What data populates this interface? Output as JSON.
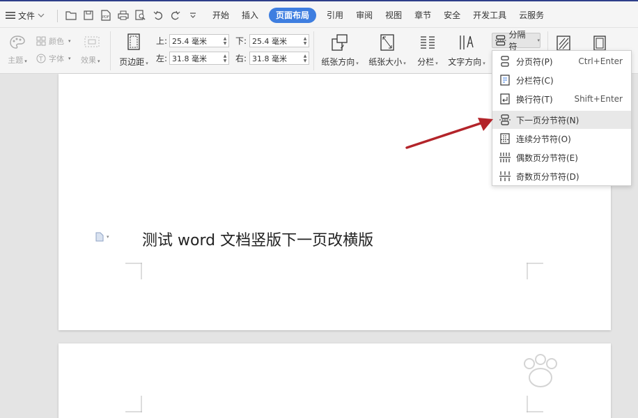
{
  "menubar": {
    "file_label": "文件",
    "tabs": [
      "开始",
      "插入",
      "页面布局",
      "引用",
      "审阅",
      "视图",
      "章节",
      "安全",
      "开发工具",
      "云服务"
    ],
    "active_tab": "页面布局"
  },
  "toolbar": {
    "theme_label": "主题",
    "color_label": "颜色",
    "font_label": "字体",
    "effect_label": "效果",
    "margin_label": "页边距",
    "top_label": "上:",
    "top_value": "25.4 毫米",
    "bottom_label": "下:",
    "bottom_value": "25.4 毫米",
    "left_label": "左:",
    "left_value": "31.8 毫米",
    "right_label": "右:",
    "right_value": "31.8 毫米",
    "orientation_label": "纸张方向",
    "size_label": "纸张大小",
    "columns_label": "分栏",
    "text_dir_label": "文字方向",
    "break_label": "分隔符"
  },
  "dropdown": {
    "items": [
      {
        "label": "分页符(P)",
        "shortcut": "Ctrl+Enter"
      },
      {
        "label": "分栏符(C)",
        "shortcut": ""
      },
      {
        "label": "换行符(T)",
        "shortcut": "Shift+Enter"
      },
      {
        "label": "下一页分节符(N)",
        "shortcut": ""
      },
      {
        "label": "连续分节符(O)",
        "shortcut": ""
      },
      {
        "label": "偶数页分节符(E)",
        "shortcut": ""
      },
      {
        "label": "奇数页分节符(D)",
        "shortcut": ""
      }
    ]
  },
  "document": {
    "text": "测试 word 文档竖版下一页改横版"
  },
  "colors": {
    "accent": "#3e7ee0",
    "arrow": "#b3242a"
  }
}
